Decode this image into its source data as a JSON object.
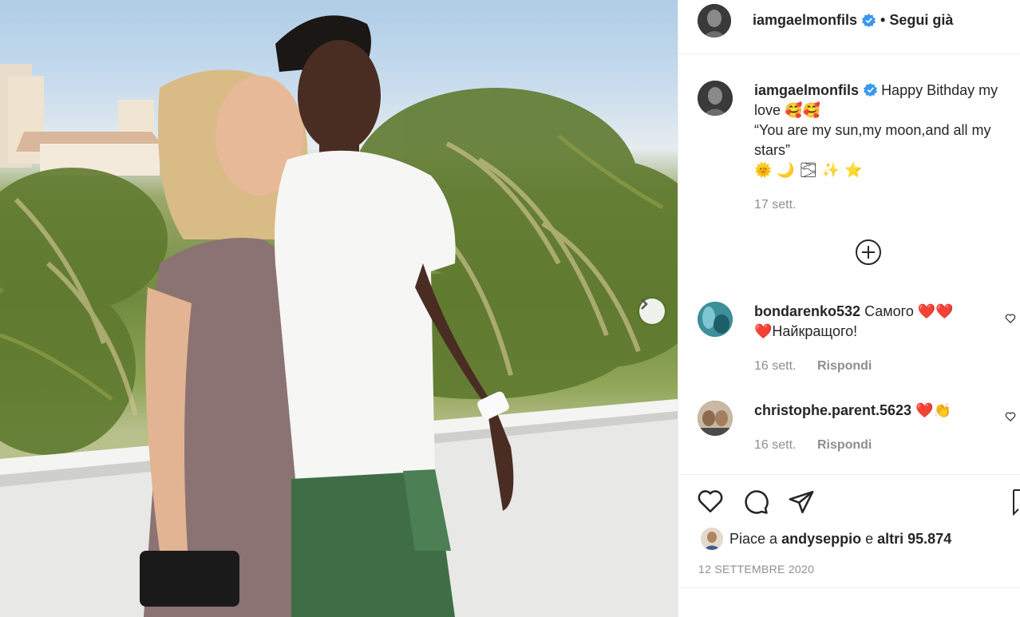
{
  "post": {
    "author": "iamgaelmonfils",
    "follow_status": "• Segui già",
    "caption_line1": "Happy Bithday my love",
    "caption_emoji1": "🥰🥰",
    "caption_line2": "“You are my sun,my moon,and all my stars”",
    "caption_emoji2": "🌞 🌙 🌫 ✨ ⭐",
    "caption_time": "17 sett.",
    "date": "12 SETTEMBRE 2020"
  },
  "comments": [
    {
      "user": "bondarenko532",
      "text_a": "Самого",
      "hearts_a": "❤️❤️",
      "hearts_b": "❤️",
      "text_b": "Найкращого!",
      "time": "16 sett.",
      "reply": "Rispondi"
    },
    {
      "user": "christophe.parent.5623",
      "hearts": "❤️👏",
      "time": "16 sett.",
      "reply": "Rispondi"
    }
  ],
  "likes": {
    "prefix": "Piace a",
    "user": "andyseppio",
    "conj": "e",
    "others": "altri 95.874"
  },
  "colors": {
    "heart_red": "#ed4956",
    "verified_blue": "#3897f0",
    "muted": "#8e8e8e"
  }
}
